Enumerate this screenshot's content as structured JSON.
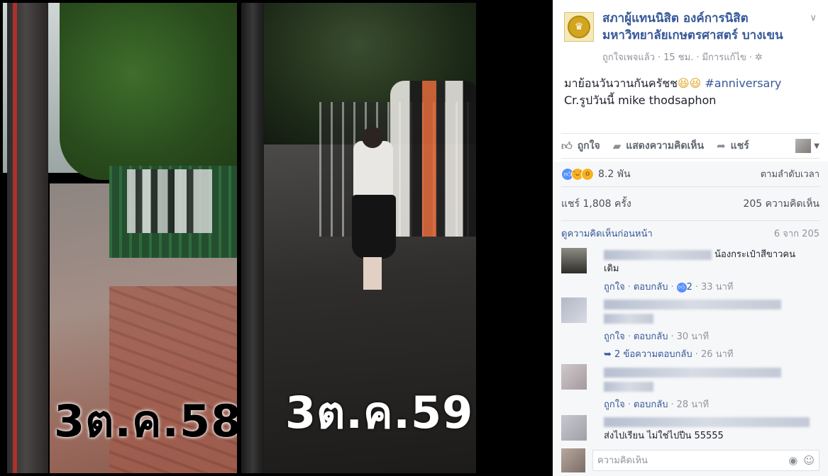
{
  "photos": {
    "left_caption": "3ต.ค.58",
    "right_caption": "3ต.ค.59"
  },
  "post": {
    "page_name": "สภาผู้แทนนิสิต องค์การนิสิต มหาวิทยาลัยเกษตรศาสตร์ บางเขน",
    "liked_page": "ถูกใจเพจแล้ว",
    "time": "15 ชม.",
    "edited": "มีการแก้ไข",
    "text_line1": "มาย้อนวันวานกันครัชช",
    "emoji": "😆😆",
    "hashtag": "#anniversary",
    "text_line2": "Cr.รูปวันนี้ mike thodsaphon"
  },
  "actions": {
    "like": "ถูกใจ",
    "comment": "แสดงความคิดเห็น",
    "share": "แชร์"
  },
  "stats": {
    "reactions_count": "8.2 พัน",
    "sort_order": "ตามลำดับเวลา",
    "shares": "แชร์ 1,808 ครั้ง",
    "comments": "205 ความคิดเห็น",
    "view_previous": "ดูความคิดเห็นก่อนหน้า",
    "shown_count": "6 จาก 205"
  },
  "comments": [
    {
      "text_visible": "น้องกระเป๋าสีขาวคน",
      "text_visible_2": "เดิม",
      "like": "ถูกใจ",
      "reply": "ตอบกลับ",
      "reactions": "2",
      "time": "33 นาที"
    },
    {
      "like": "ถูกใจ",
      "reply": "ตอบกลับ",
      "time": "30 นาที",
      "replies_link": "2 ข้อความตอบกลับ",
      "replies_time": "26 นาที"
    },
    {
      "like": "ถูกใจ",
      "reply": "ตอบกลับ",
      "time": "28 นาที"
    },
    {
      "text_visible": "ส่งไปเรียน ไม่ใช่ไปปีน 55555"
    }
  ],
  "composer": {
    "placeholder": "ความคิดเห็น"
  }
}
